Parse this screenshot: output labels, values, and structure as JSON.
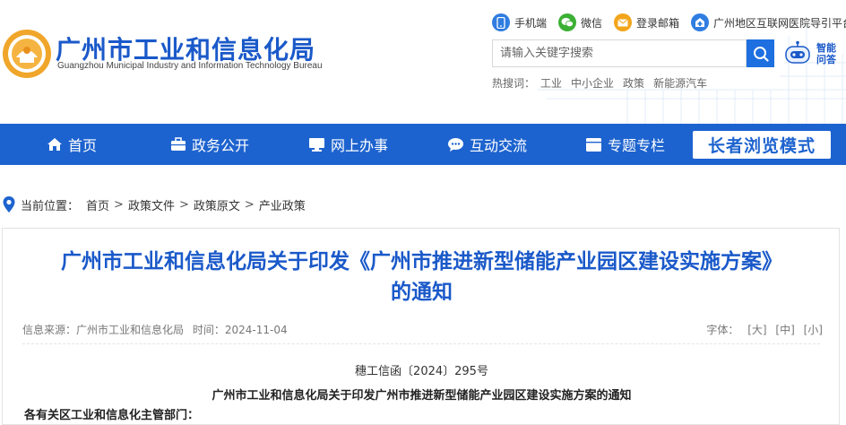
{
  "header": {
    "title": "广州市工业和信息化局",
    "subtitle": "Guangzhou Municipal Industry and Information Technology Bureau",
    "toplinks": [
      {
        "label": "手机端",
        "icon": "mobile-icon",
        "color": "#2f7de1"
      },
      {
        "label": "微信",
        "icon": "wechat-icon",
        "color": "#3cb034"
      },
      {
        "label": "登录邮箱",
        "icon": "mail-icon",
        "color": "#f2a51a"
      },
      {
        "label": "广州地区互联网医院导引平台",
        "icon": "hospital-icon",
        "color": "#2f7de1"
      }
    ],
    "search": {
      "placeholder": "请输入关键字搜索"
    },
    "robot": {
      "label": "智能\n问答"
    },
    "hot": {
      "label": "热搜词：",
      "words": [
        "工业",
        "中小企业",
        "政策",
        "新能源汽车"
      ]
    }
  },
  "nav": {
    "items": [
      {
        "label": "首页",
        "icon": "home-icon"
      },
      {
        "label": "政务公开",
        "icon": "briefcase-icon"
      },
      {
        "label": "网上办事",
        "icon": "monitor-icon"
      },
      {
        "label": "互动交流",
        "icon": "chat-icon"
      },
      {
        "label": "专题专栏",
        "icon": "column-icon"
      }
    ],
    "elder_mode": "长者浏览模式"
  },
  "breadcrumb": {
    "label": "当前位置：",
    "items": [
      "首页",
      "政策文件",
      "政策原文",
      "产业政策"
    ],
    "separator": ">"
  },
  "article": {
    "title_line1": "广州市工业和信息化局关于印发《广州市推进新型储能产业园区建设实施方案》",
    "title_line2": "的通知",
    "source_label": "信息来源：",
    "source": "广州市工业和信息化局",
    "time_label": "时间：",
    "time": "2024-11-04",
    "font_label": "字体：",
    "font_sizes": [
      "[大]",
      "[中]",
      "[小]"
    ],
    "doc_number": "穗工信函〔2024〕295号",
    "doc_title": "广州市工业和信息化局关于印发广州市推进新型储能产业园区建设实施方案的通知",
    "first_line": "各有关区工业和信息化主管部门："
  },
  "colors": {
    "brand": "#1a59c9",
    "nav": "#1d63cf",
    "search": "#1e6fe0"
  }
}
